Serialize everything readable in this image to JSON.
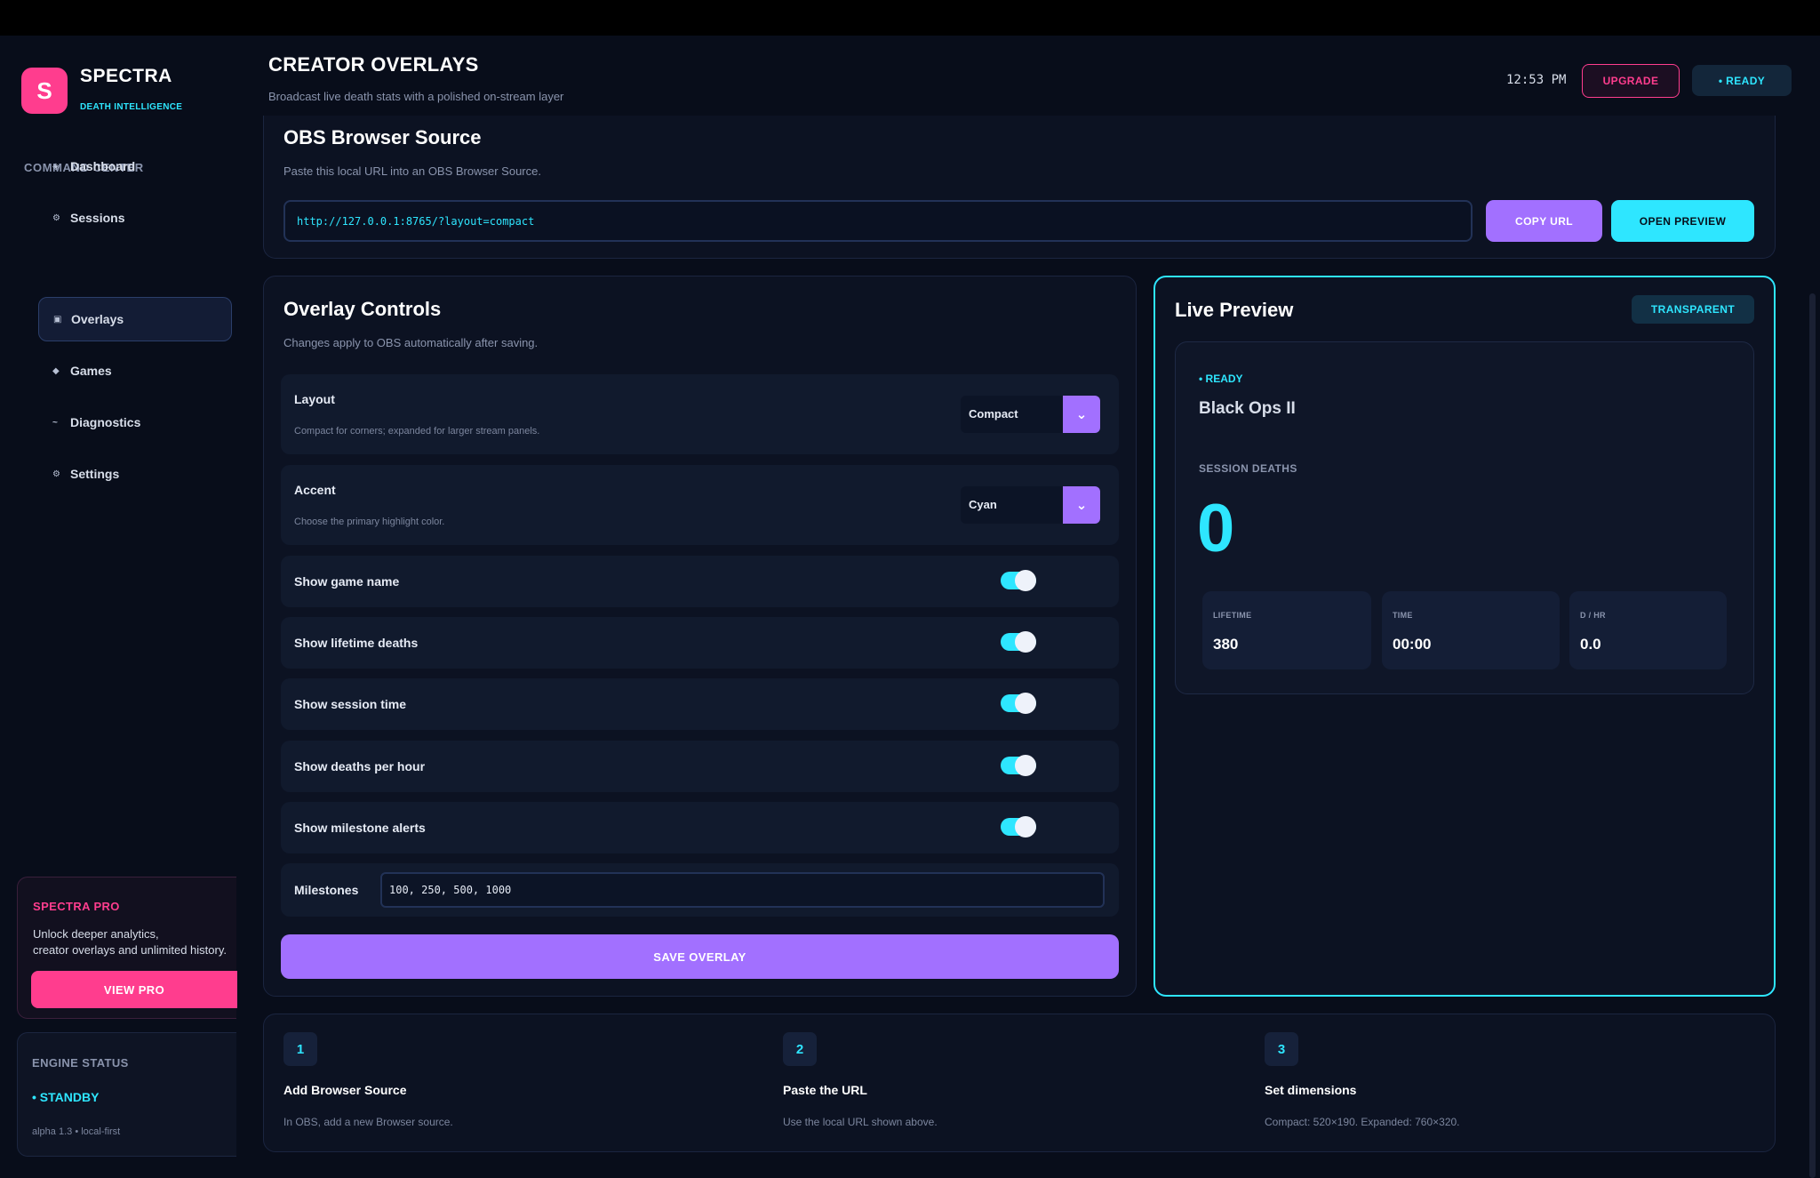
{
  "sidebar": {
    "logo_letter": "S",
    "brand": "SPECTRA",
    "brand_sub": "DEATH INTELLIGENCE",
    "section_label": "COMMAND CENTER",
    "items": [
      {
        "icon": "◈",
        "label": "Dashboard"
      },
      {
        "icon": "⚙",
        "label": "Sessions"
      },
      {
        "icon": "▣",
        "label": "Overlays"
      },
      {
        "icon": "◆",
        "label": "Games"
      },
      {
        "icon": "~",
        "label": "Diagnostics"
      },
      {
        "icon": "⚙",
        "label": "Settings"
      }
    ],
    "active_item": "Overlays",
    "pro": {
      "title": "SPECTRA PRO",
      "text": "Unlock deeper analytics,\ncreator overlays and unlimited history.",
      "button": "VIEW PRO"
    },
    "engine": {
      "title": "ENGINE STATUS",
      "status": "• STANDBY",
      "meta": "alpha 1.3 • local-first"
    }
  },
  "header": {
    "title": "CREATOR OVERLAYS",
    "subtitle": "Broadcast live death stats with a polished on-stream layer",
    "clock": "12:53 PM",
    "upgrade": "UPGRADE",
    "status": "• READY"
  },
  "obs": {
    "title": "OBS Browser Source",
    "subtitle": "Paste this local URL into an OBS Browser Source.",
    "url": "http://127.0.0.1:8765/?layout=compact",
    "copy_label": "COPY URL",
    "preview_label": "OPEN PREVIEW"
  },
  "controls": {
    "title": "Overlay Controls",
    "subtitle": "Changes apply to OBS automatically after saving.",
    "layout": {
      "label": "Layout",
      "help": "Compact for corners; expanded for larger stream panels.",
      "value": "Compact"
    },
    "accent": {
      "label": "Accent",
      "help": "Choose the primary highlight color.",
      "value": "Cyan"
    },
    "toggles": [
      {
        "label": "Show game name",
        "on": true
      },
      {
        "label": "Show lifetime deaths",
        "on": true
      },
      {
        "label": "Show session time",
        "on": true
      },
      {
        "label": "Show deaths per hour",
        "on": true
      },
      {
        "label": "Show milestone alerts",
        "on": true
      }
    ],
    "milestones": {
      "label": "Milestones",
      "value": "100, 250, 500, 1000"
    },
    "save_label": "SAVE OVERLAY"
  },
  "preview": {
    "title": "Live Preview",
    "badge": "TRANSPARENT",
    "status": "• READY",
    "game": "Black Ops II",
    "session_label": "SESSION DEATHS",
    "session_value": "0",
    "stats": [
      {
        "label": "LIFETIME",
        "value": "380"
      },
      {
        "label": "TIME",
        "value": "00:00"
      },
      {
        "label": "D / HR",
        "value": "0.0"
      }
    ]
  },
  "steps": [
    {
      "num": "1",
      "title": "Add Browser Source",
      "desc": "In OBS, add a new Browser source."
    },
    {
      "num": "2",
      "title": "Paste the URL",
      "desc": "Use the local URL shown above."
    },
    {
      "num": "3",
      "title": "Set dimensions",
      "desc": "Compact: 520×190. Expanded: 760×320."
    }
  ],
  "colors": {
    "accent_cyan": "#2ee6ff",
    "accent_pink": "#ff3d8e",
    "accent_purple": "#a270ff",
    "background": "#080d1a"
  }
}
